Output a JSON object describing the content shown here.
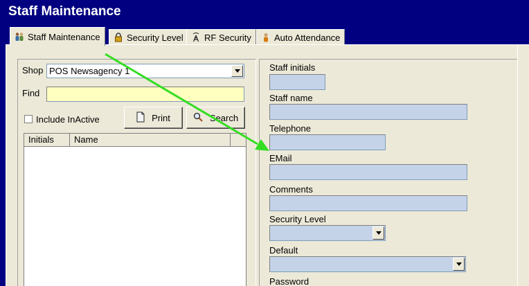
{
  "window": {
    "title": "Staff Maintenance"
  },
  "tabs": [
    {
      "label": "Staff Maintenance",
      "icon": "people-icon",
      "active": true
    },
    {
      "label": "Security Level",
      "icon": "lock-icon",
      "active": false
    },
    {
      "label": "RF Security",
      "icon": "antenna-icon",
      "active": false
    },
    {
      "label": "Auto Attendance",
      "icon": "person-icon",
      "active": false
    }
  ],
  "left": {
    "shop_label": "Shop",
    "shop_value": "POS Newsagency 1",
    "find_label": "Find",
    "find_value": "",
    "include_inactive_label": "Include InActive",
    "include_inactive_checked": false,
    "print_label": "Print",
    "search_label": "Search",
    "columns": [
      "Initials",
      "Name"
    ]
  },
  "right": {
    "staff_initials_label": "Staff initials",
    "staff_name_label": "Staff name",
    "telephone_label": "Telephone",
    "email_label": "EMail",
    "comments_label": "Comments",
    "security_level_label": "Security Level",
    "default_label": "Default",
    "password_label": "Password"
  },
  "colors": {
    "title_bg": "#000080",
    "panel_bg": "#ece9d8",
    "field_bg": "#c5d3e8",
    "find_bg": "#ffffc0",
    "annotation_arrow": "#33dd22"
  }
}
